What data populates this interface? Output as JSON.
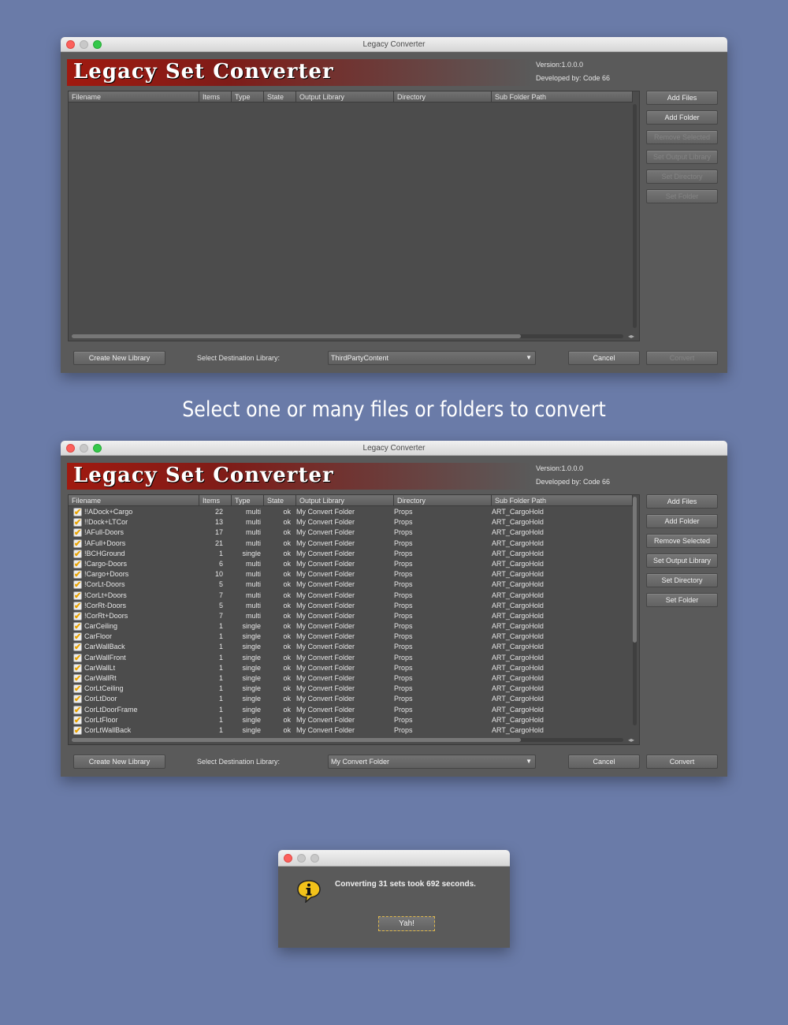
{
  "app": {
    "window_title": "Legacy Converter",
    "banner_title": "Legacy Set Converter",
    "version": "Version:1.0.0.0",
    "developer": "Developed by: Code 66"
  },
  "columns": [
    "Filename",
    "Items",
    "Type",
    "State",
    "Output Library",
    "Directory",
    "Sub Folder Path"
  ],
  "buttons": {
    "add_files": "Add Files",
    "add_folder": "Add Folder",
    "remove_selected": "Remove Selected",
    "set_output_library": "Set Output Library",
    "set_directory": "Set Directory",
    "set_folder": "Set Folder",
    "create_new_library": "Create New Library",
    "cancel": "Cancel",
    "convert": "Convert"
  },
  "destination_label": "Select Destination Library:",
  "window1": {
    "destination": "ThirdPartyContent"
  },
  "caption": "Select one or many files or folders to convert",
  "window2": {
    "destination": "My Convert Folder",
    "rows": [
      {
        "file": "!!ADock+Cargo",
        "items": "22",
        "type": "multi",
        "state": "ok",
        "out": "My Convert Folder",
        "dir": "Props",
        "sub": "ART_CargoHold"
      },
      {
        "file": "!!Dock+LTCor",
        "items": "13",
        "type": "multi",
        "state": "ok",
        "out": "My Convert Folder",
        "dir": "Props",
        "sub": "ART_CargoHold"
      },
      {
        "file": "!AFull-Doors",
        "items": "17",
        "type": "multi",
        "state": "ok",
        "out": "My Convert Folder",
        "dir": "Props",
        "sub": "ART_CargoHold"
      },
      {
        "file": "!AFull+Doors",
        "items": "21",
        "type": "multi",
        "state": "ok",
        "out": "My Convert Folder",
        "dir": "Props",
        "sub": "ART_CargoHold"
      },
      {
        "file": "!BCHGround",
        "items": "1",
        "type": "single",
        "state": "ok",
        "out": "My Convert Folder",
        "dir": "Props",
        "sub": "ART_CargoHold"
      },
      {
        "file": "!Cargo-Doors",
        "items": "6",
        "type": "multi",
        "state": "ok",
        "out": "My Convert Folder",
        "dir": "Props",
        "sub": "ART_CargoHold"
      },
      {
        "file": "!Cargo+Doors",
        "items": "10",
        "type": "multi",
        "state": "ok",
        "out": "My Convert Folder",
        "dir": "Props",
        "sub": "ART_CargoHold"
      },
      {
        "file": "!CorLt-Doors",
        "items": "5",
        "type": "multi",
        "state": "ok",
        "out": "My Convert Folder",
        "dir": "Props",
        "sub": "ART_CargoHold"
      },
      {
        "file": "!CorLt+Doors",
        "items": "7",
        "type": "multi",
        "state": "ok",
        "out": "My Convert Folder",
        "dir": "Props",
        "sub": "ART_CargoHold"
      },
      {
        "file": "!CorRt-Doors",
        "items": "5",
        "type": "multi",
        "state": "ok",
        "out": "My Convert Folder",
        "dir": "Props",
        "sub": "ART_CargoHold"
      },
      {
        "file": "!CorRt+Doors",
        "items": "7",
        "type": "multi",
        "state": "ok",
        "out": "My Convert Folder",
        "dir": "Props",
        "sub": "ART_CargoHold"
      },
      {
        "file": "CarCeiling",
        "items": "1",
        "type": "single",
        "state": "ok",
        "out": "My Convert Folder",
        "dir": "Props",
        "sub": "ART_CargoHold"
      },
      {
        "file": "CarFloor",
        "items": "1",
        "type": "single",
        "state": "ok",
        "out": "My Convert Folder",
        "dir": "Props",
        "sub": "ART_CargoHold"
      },
      {
        "file": "CarWallBack",
        "items": "1",
        "type": "single",
        "state": "ok",
        "out": "My Convert Folder",
        "dir": "Props",
        "sub": "ART_CargoHold"
      },
      {
        "file": "CarWallFront",
        "items": "1",
        "type": "single",
        "state": "ok",
        "out": "My Convert Folder",
        "dir": "Props",
        "sub": "ART_CargoHold"
      },
      {
        "file": "CarWallLt",
        "items": "1",
        "type": "single",
        "state": "ok",
        "out": "My Convert Folder",
        "dir": "Props",
        "sub": "ART_CargoHold"
      },
      {
        "file": "CarWallRt",
        "items": "1",
        "type": "single",
        "state": "ok",
        "out": "My Convert Folder",
        "dir": "Props",
        "sub": "ART_CargoHold"
      },
      {
        "file": "CorLtCeiling",
        "items": "1",
        "type": "single",
        "state": "ok",
        "out": "My Convert Folder",
        "dir": "Props",
        "sub": "ART_CargoHold"
      },
      {
        "file": "CorLtDoor",
        "items": "1",
        "type": "single",
        "state": "ok",
        "out": "My Convert Folder",
        "dir": "Props",
        "sub": "ART_CargoHold"
      },
      {
        "file": "CorLtDoorFrame",
        "items": "1",
        "type": "single",
        "state": "ok",
        "out": "My Convert Folder",
        "dir": "Props",
        "sub": "ART_CargoHold"
      },
      {
        "file": "CorLtFloor",
        "items": "1",
        "type": "single",
        "state": "ok",
        "out": "My Convert Folder",
        "dir": "Props",
        "sub": "ART_CargoHold"
      },
      {
        "file": "CorLtWallBack",
        "items": "1",
        "type": "single",
        "state": "ok",
        "out": "My Convert Folder",
        "dir": "Props",
        "sub": "ART_CargoHold"
      }
    ]
  },
  "dialog": {
    "message": "Converting 31 sets took 692 seconds.",
    "button": "Yah!",
    "icon": "info-icon"
  },
  "colors": {
    "background": "#6a7ba8",
    "window": "#5a5a5a",
    "banner_red": "#a01a10",
    "check": "#e8a200",
    "info_yellow": "#f2c21a"
  }
}
